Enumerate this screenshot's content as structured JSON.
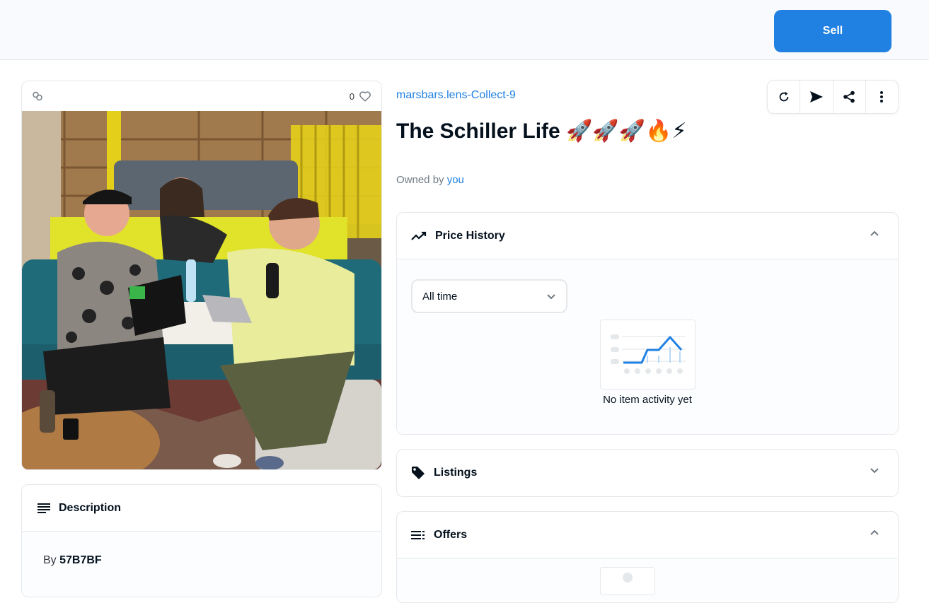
{
  "header": {
    "sell_label": "Sell"
  },
  "media": {
    "favorite_count": "0",
    "chain_icon": "link-icon",
    "favorite_icon": "heart-icon"
  },
  "description": {
    "heading": "Description",
    "by_label": "By",
    "creator": "57B7BF"
  },
  "item": {
    "collection": "marsbars.lens-Collect-9",
    "title": "The Schiller Life 🚀🚀🚀🔥⚡",
    "owned_by_label": "Owned by",
    "owner": "you"
  },
  "actions": [
    "refresh-icon",
    "transfer-icon",
    "share-icon",
    "more-icon"
  ],
  "price_history": {
    "heading": "Price History",
    "filter_value": "All time",
    "empty_text": "No item activity yet"
  },
  "listings": {
    "heading": "Listings"
  },
  "offers": {
    "heading": "Offers"
  },
  "colors": {
    "accent": "#2081e2",
    "border": "#e5e8eb",
    "text": "#04111d",
    "muted": "#707a83"
  }
}
